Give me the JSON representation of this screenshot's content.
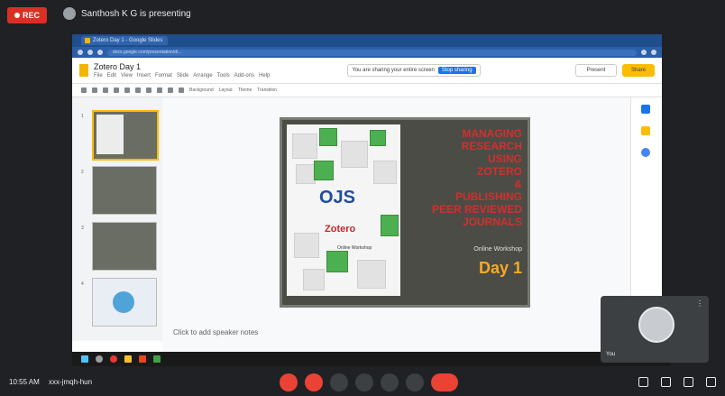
{
  "meet": {
    "rec_label": "REC",
    "presenter_text": "Santhosh K G is presenting",
    "time_text": "10:55 AM",
    "meeting_code": "xxx-jmqh-hun",
    "self_view_name": "You"
  },
  "browser": {
    "tab_title": "Zotero Day 1 - Google Slides",
    "url": "docs.google.com/presentation/d/..."
  },
  "slides_app": {
    "doc_title": "Zotero Day 1",
    "menu": [
      "File",
      "Edit",
      "View",
      "Insert",
      "Format",
      "Slide",
      "Arrange",
      "Tools",
      "Add-ons",
      "Help"
    ],
    "share_banner": "You are sharing your entire screen",
    "stop_sharing_label": "Stop sharing",
    "present_label": "Present",
    "share_label": "Share",
    "toolbar_labels": [
      "Background",
      "Layout",
      "Theme",
      "Transition"
    ],
    "speaker_notes": "Click to add speaker notes",
    "thumb_numbers": [
      "1",
      "2",
      "3",
      "4"
    ]
  },
  "slide": {
    "title_lines": [
      "MANAGING",
      "RESEARCH",
      "USING",
      "ZOTERO",
      "&",
      "PUBLISHING",
      "PEER REVIEWED",
      "JOURNALS"
    ],
    "ojs_text": "OJS",
    "zotero_text": "Zotero",
    "small_text": "Online Workshop",
    "subtitle": "Online Workshop",
    "day_label": "Day 1"
  },
  "colors": {
    "rec": "#d93025",
    "slide_bg": "#4a4c45",
    "title_red": "#d32f2f",
    "day_gold": "#f9a825",
    "share_yellow": "#fbbc04",
    "chrome_blue": "#2b5fa7"
  }
}
